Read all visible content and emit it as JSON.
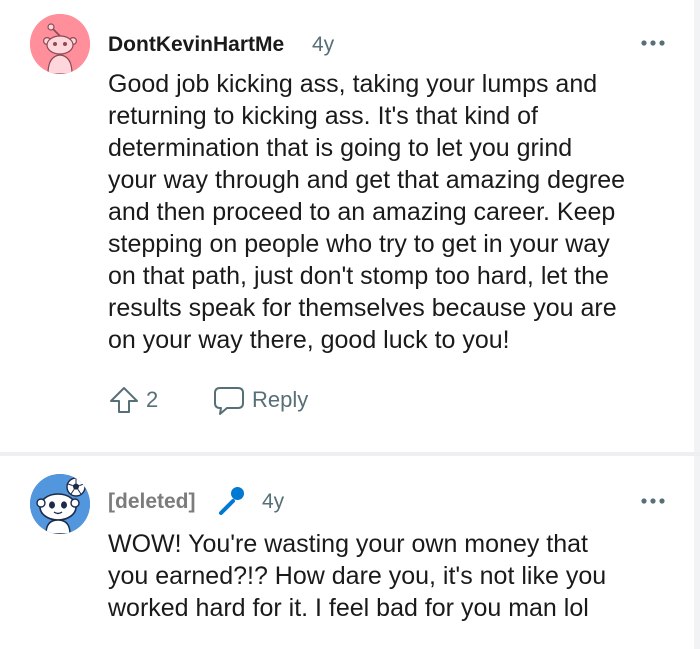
{
  "comments": [
    {
      "username": "DontKevinHartMe",
      "age": "4y",
      "avatar_icon": "snoo-avatar-icon",
      "avatar_color": "#ff8f9a",
      "body": "Good job kicking ass, taking your lumps and\nreturning to kicking ass. It's that kind of\ndetermination that is going to let you grind\nyour way through and get that amazing degree\nand then proceed to an amazing career. Keep\nstepping on people who try to get in your way\non that path, just don't stomp too hard, let the\nresults speak for themselves because you are\non your way there, good luck to you!",
      "vote_count": "2",
      "reply_label": "Reply"
    },
    {
      "username": "[deleted]",
      "age": "4y",
      "avatar_icon": "snoo-soccer-avatar-icon",
      "avatar_color": "#5296dd",
      "flair_icon": "microphone-icon",
      "body": "WOW! You're wasting your own money that\nyou earned?!? How dare you, it's not like you\nworked hard for it. I feel bad for you man lol"
    }
  ]
}
